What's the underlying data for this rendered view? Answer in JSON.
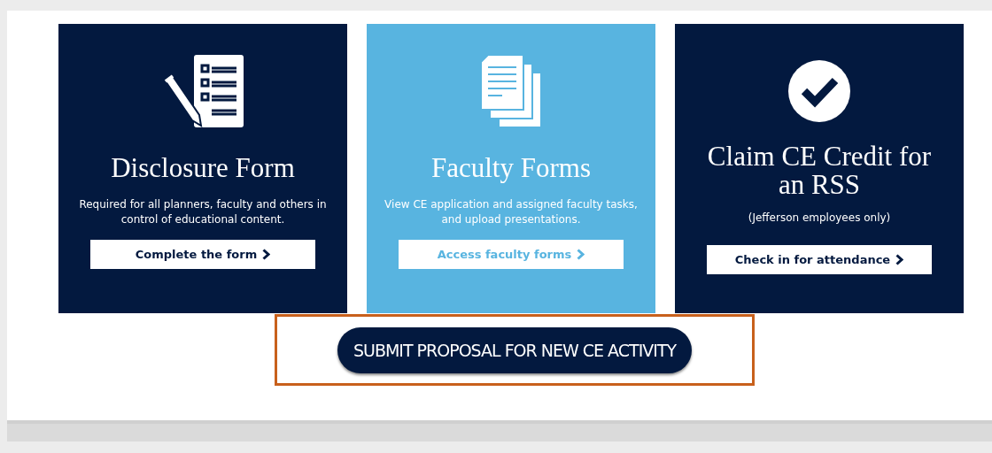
{
  "cards": [
    {
      "title": "Disclosure Form",
      "description": "Required for all planners, faculty and others in control of educational content.",
      "link": "Complete the form",
      "color": "#03193f"
    },
    {
      "title": "Faculty Forms",
      "description": "View CE application and assigned faculty tasks, and upload presentations.",
      "link": "Access faculty forms",
      "color": "#58b4e0"
    },
    {
      "title": "Claim CE Credit for an RSS",
      "description": "(Jefferson employees only)",
      "link": "Check in for attendance",
      "color": "#03193f"
    }
  ],
  "proposal_button": {
    "label": "SUBMIT PROPOSAL FOR NEW CE ACTIVITY",
    "highlighted": true
  }
}
